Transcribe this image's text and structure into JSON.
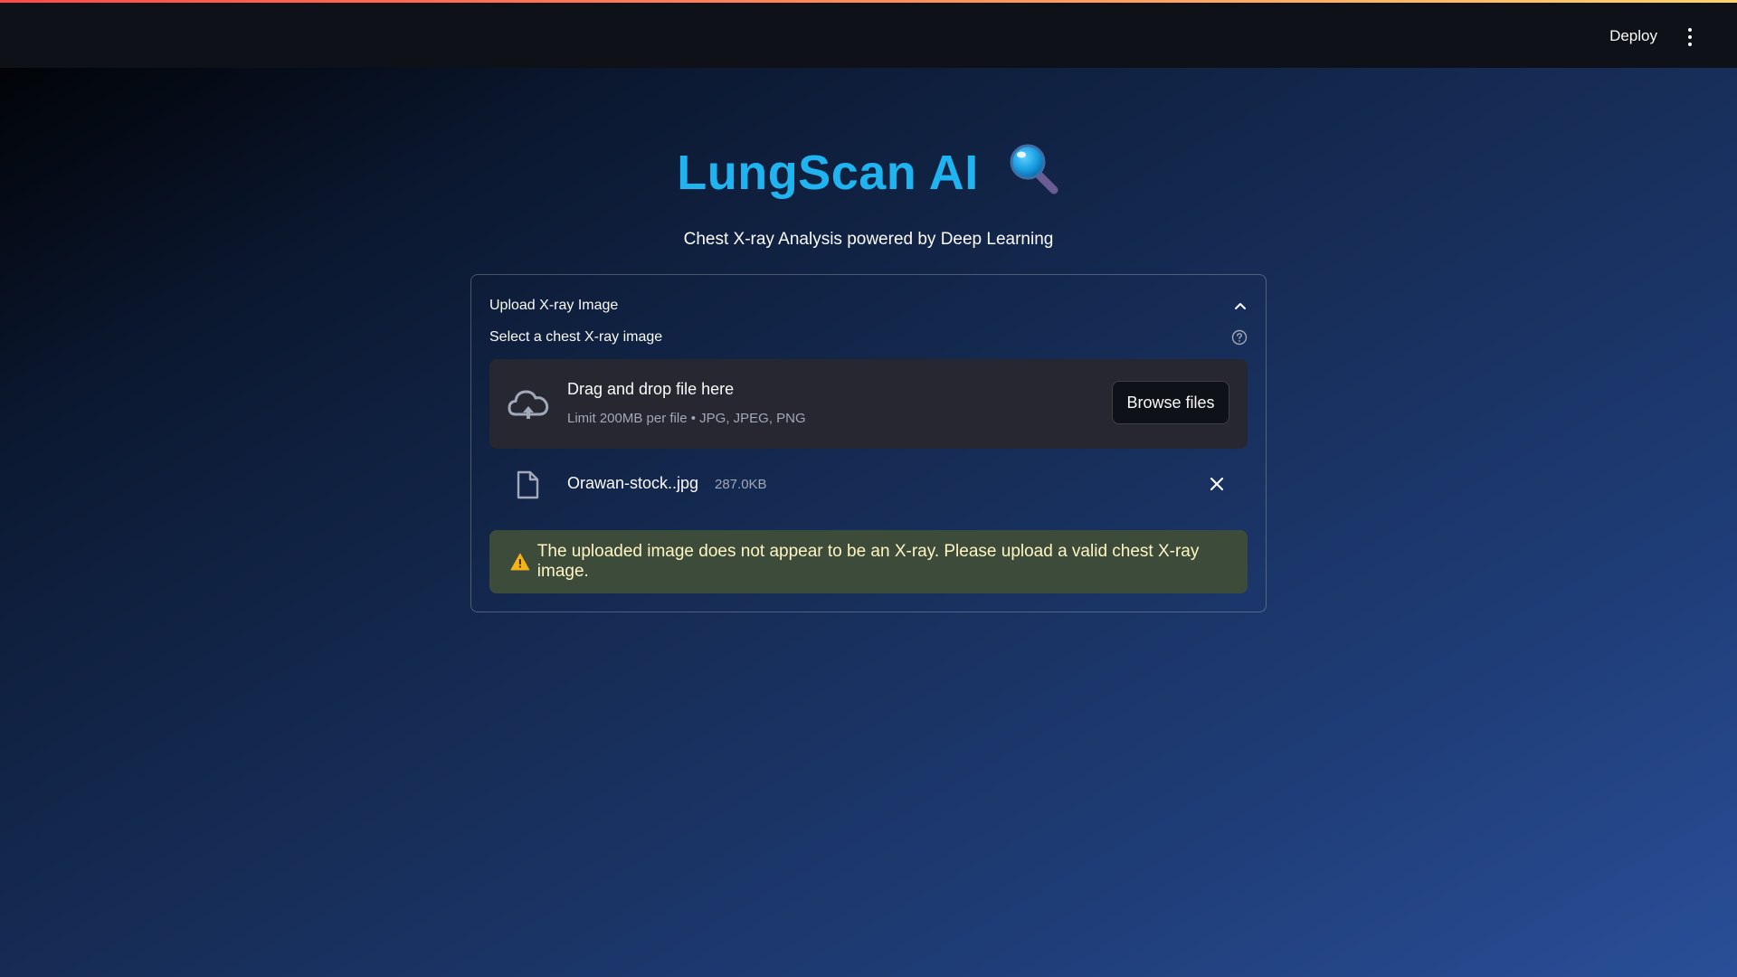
{
  "app": {
    "title": "LungScan AI",
    "subtitle": "Chest X-ray Analysis powered by Deep Learning"
  },
  "header": {
    "deploy_label": "Deploy",
    "menu_icon": "vertical-dots-icon"
  },
  "expander": {
    "title": "Upload X-ray Image",
    "expanded": true
  },
  "uploader": {
    "label": "Select a chest X-ray image",
    "drop_title": "Drag and drop file here",
    "limit_text": "Limit 200MB per file • JPG, JPEG, PNG",
    "browse_label": "Browse files"
  },
  "file": {
    "name": "Orawan-stock..jpg",
    "size": "287.0KB"
  },
  "warning": {
    "message": "The uploaded image does not appear to be an X-ray. Please upload a valid chest X-ray image."
  },
  "colors": {
    "title": "#1fb4f0",
    "header_bg": "#0e1117",
    "dropzone_bg": "#262730",
    "warning_bg": "#3d4b3a",
    "warning_text": "#fff5c2"
  }
}
